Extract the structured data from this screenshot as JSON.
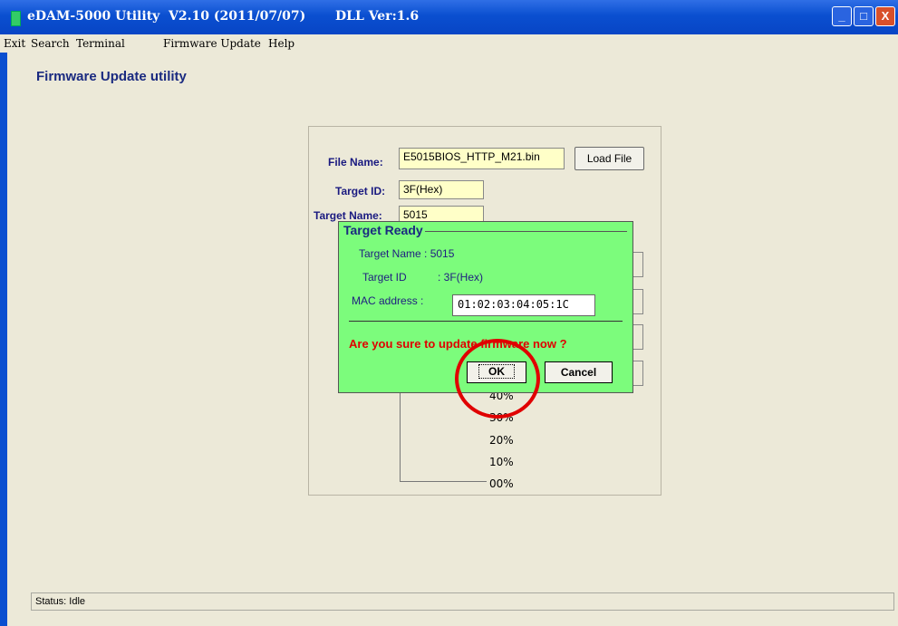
{
  "window": {
    "title": "eDAM-5000 Utility  V2.10 (2011/07/07)",
    "dll_version": "DLL Ver:1.6",
    "controls": {
      "minimize": "_",
      "maximize": "□",
      "close": "X"
    }
  },
  "menu": [
    "Exit",
    "Search",
    "Terminal",
    "Firmware Update",
    "Help"
  ],
  "page_title": "Firmware Update utility",
  "form": {
    "file_name_label": "File Name:",
    "file_name_value": "E5015BIOS_HTTP_M21.bin",
    "load_file_button": "Load File",
    "target_id_label": "Target ID:",
    "target_id_value": "3F(Hex)",
    "target_name_label": "Target Name:",
    "target_name_value": "5015"
  },
  "progress": {
    "tick_labels": [
      "40%",
      "30%",
      "20%",
      "10%",
      "00%"
    ]
  },
  "dialog": {
    "title": "Target Ready",
    "target_name_line": "Target Name : 5015",
    "target_id_label": "Target ID",
    "target_id_value": ": 3F(Hex)",
    "mac_label": "MAC address :",
    "mac_value": "01:02:03:04:05:1C",
    "confirm_text": "Are you sure to update firmware now ?",
    "ok_button": "OK",
    "cancel_button": "Cancel"
  },
  "status": {
    "text": "Status: Idle"
  },
  "colors": {
    "dialog_bg": "#7cfc7c",
    "warning_text": "#e00000",
    "highlight_circle": "#e00000",
    "field_bg": "#ffffc8"
  }
}
